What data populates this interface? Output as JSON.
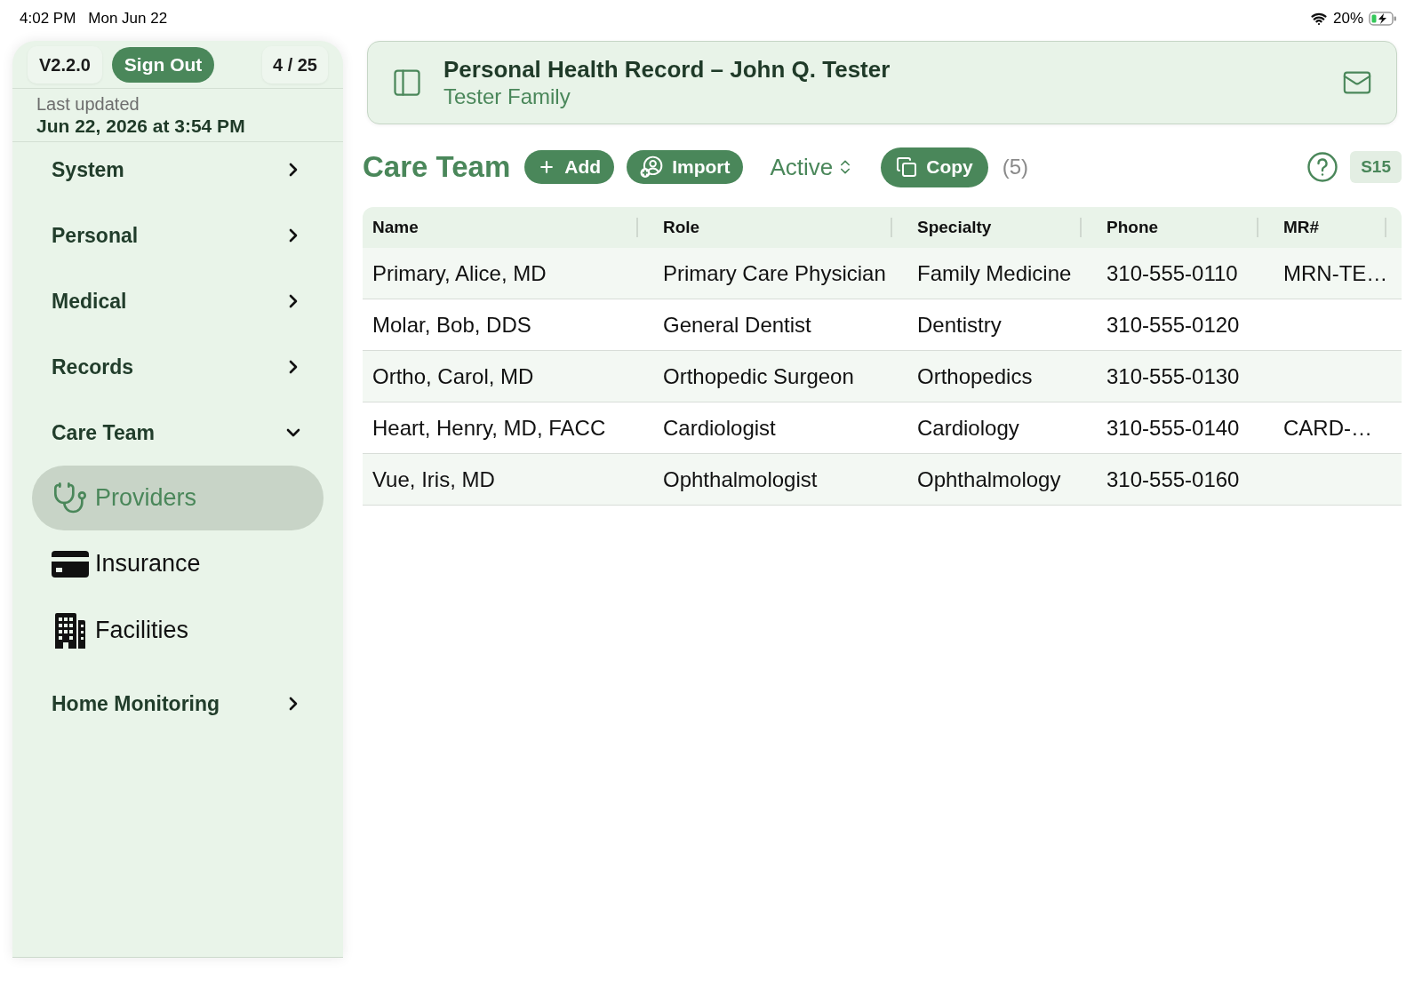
{
  "status_bar": {
    "time": "4:02 PM",
    "date": "Mon Jun 22",
    "battery": "20%",
    "charging": true
  },
  "sidebar": {
    "version": "V2.2.0",
    "sign_out": "Sign Out",
    "page_counter": "4 / 25",
    "last_updated_label": "Last updated",
    "last_updated": "Jun 22, 2026 at 3:54 PM",
    "items": [
      {
        "label": "System",
        "expanded": false
      },
      {
        "label": "Personal",
        "expanded": false
      },
      {
        "label": "Medical",
        "expanded": false
      },
      {
        "label": "Records",
        "expanded": false
      },
      {
        "label": "Care Team",
        "expanded": true,
        "children": [
          {
            "label": "Providers",
            "selected": true
          },
          {
            "label": "Insurance",
            "selected": false
          },
          {
            "label": "Facilities",
            "selected": false
          }
        ]
      },
      {
        "label": "Home Monitoring",
        "expanded": false
      }
    ]
  },
  "header": {
    "title": "Personal Health Record – John Q. Tester",
    "subtitle": "Tester Family"
  },
  "toolbar": {
    "title": "Care Team",
    "controls": [
      {
        "kind": "button",
        "label": "Add"
      },
      {
        "kind": "button",
        "label": "Import"
      },
      {
        "kind": "picker",
        "label": "Active"
      },
      {
        "kind": "button",
        "label": "Copy"
      }
    ],
    "count": "(5)",
    "badge": "S15"
  },
  "table": {
    "columns": [
      "Name",
      "Role",
      "Specialty",
      "Phone",
      "MR#"
    ],
    "rows": [
      {
        "name": "Primary, Alice, MD",
        "role": "Primary Care Physician",
        "specialty": "Family Medicine",
        "phone": "310-555-0110",
        "mr_number": "MRN-TE…"
      },
      {
        "name": "Molar, Bob, DDS",
        "role": "General Dentist",
        "specialty": "Dentistry",
        "phone": "310-555-0120"
      },
      {
        "name": "Ortho, Carol, MD",
        "role": "Orthopedic Surgeon",
        "specialty": "Orthopedics",
        "phone": "310-555-0130"
      },
      {
        "name": "Heart, Henry, MD, FACC",
        "role": "Cardiologist",
        "specialty": "Cardiology",
        "phone": "310-555-0140",
        "mr_number": "CARD-…"
      },
      {
        "name": "Vue, Iris, MD",
        "role": "Ophthalmologist",
        "specialty": "Ophthalmology",
        "phone": "310-555-0160"
      }
    ]
  }
}
